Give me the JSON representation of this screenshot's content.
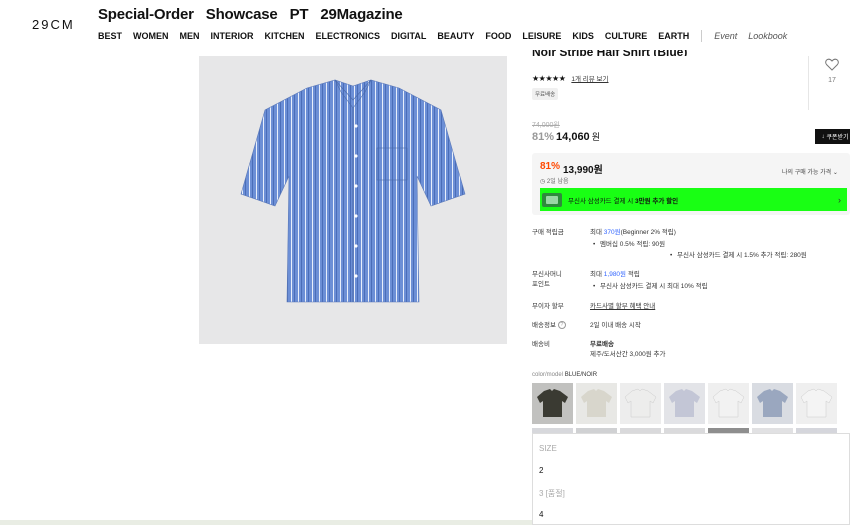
{
  "header": {
    "logo": "29CM",
    "top_nav": [
      "Special-Order",
      "Showcase",
      "PT",
      "29Magazine"
    ],
    "categories": [
      "BEST",
      "WOMEN",
      "MEN",
      "INTERIOR",
      "KITCHEN",
      "ELECTRONICS",
      "DIGITAL",
      "BEAUTY",
      "FOOD",
      "LEISURE",
      "KIDS",
      "CULTURE",
      "EARTH"
    ],
    "extra_links": [
      "Event",
      "Lookbook"
    ]
  },
  "product": {
    "title": "Noir Stripe Half Shirt (Blue)",
    "stars": "★★★★★",
    "review_link": "1개 리뷰 보기",
    "badge": "무료배송",
    "like_count": "17",
    "original_price": "74,000원",
    "discount_rate": "81%",
    "price": "14,060",
    "price_unit": "원",
    "coupon_button": "쿠폰받기",
    "benefit": {
      "discount_rate": "81%",
      "price": "13,990원",
      "time_left": "2일 남음",
      "my_price_label": "나의 구매 가능 가격",
      "banner_prefix": "무신사 삼성카드 결제 시 ",
      "banner_bold": "3만원 추가 할인"
    },
    "details": {
      "points_label": "구매 적립금",
      "points_value_prefix": "최대 ",
      "points_value_amount": "370원",
      "points_value_suffix": "(Beginner 2% 적립)",
      "points_b1": "멤버십 0.5% 적립: 90원",
      "points_b2": "무신사 삼성카드 결제 시 1.5% 추가 적립: 280원",
      "musinsa_label_1": "무신사머니",
      "musinsa_label_2": "포인트",
      "musinsa_value_prefix": "최대 ",
      "musinsa_value_amount": "1,980원",
      "musinsa_value_suffix": " 적립",
      "musinsa_b1": "무신사 삼성카드 결제 시 최대 10% 적립",
      "installment_label": "무이자 할부",
      "installment_value": "카드사별 할부 혜택 안내",
      "shipping_info_label": "배송정보",
      "shipping_info_value": "2일 이내 배송 시작",
      "shipping_fee_label": "배송비",
      "shipping_fee_value_1": "무료배송",
      "shipping_fee_value_2": "제주/도서산간 3,000원 추가"
    },
    "color_label": "color/model",
    "color_value": "BLUE/NOIR",
    "thumb_colors": [
      "#3a3a32",
      "#d8d6cc",
      "#ededec",
      "#c3c6d6",
      "#f2f2f2",
      "#9aa7bf",
      "#f4f4f4"
    ],
    "thumb2_colors": [
      "#d7d8dc",
      "#d0d1d3",
      "#d9d9db",
      "#dadadc",
      "#8e8e8e",
      "#e1e1e3",
      "#d5d6dc"
    ]
  },
  "dropdown": {
    "options": [
      "SIZE",
      "2",
      "3 [품절]",
      "4"
    ]
  },
  "colors": {
    "accent_red": "#ff4800",
    "banner_green": "#19ff14",
    "link_blue": "#3366ff",
    "shirt_blue": "#6c8fd6"
  }
}
